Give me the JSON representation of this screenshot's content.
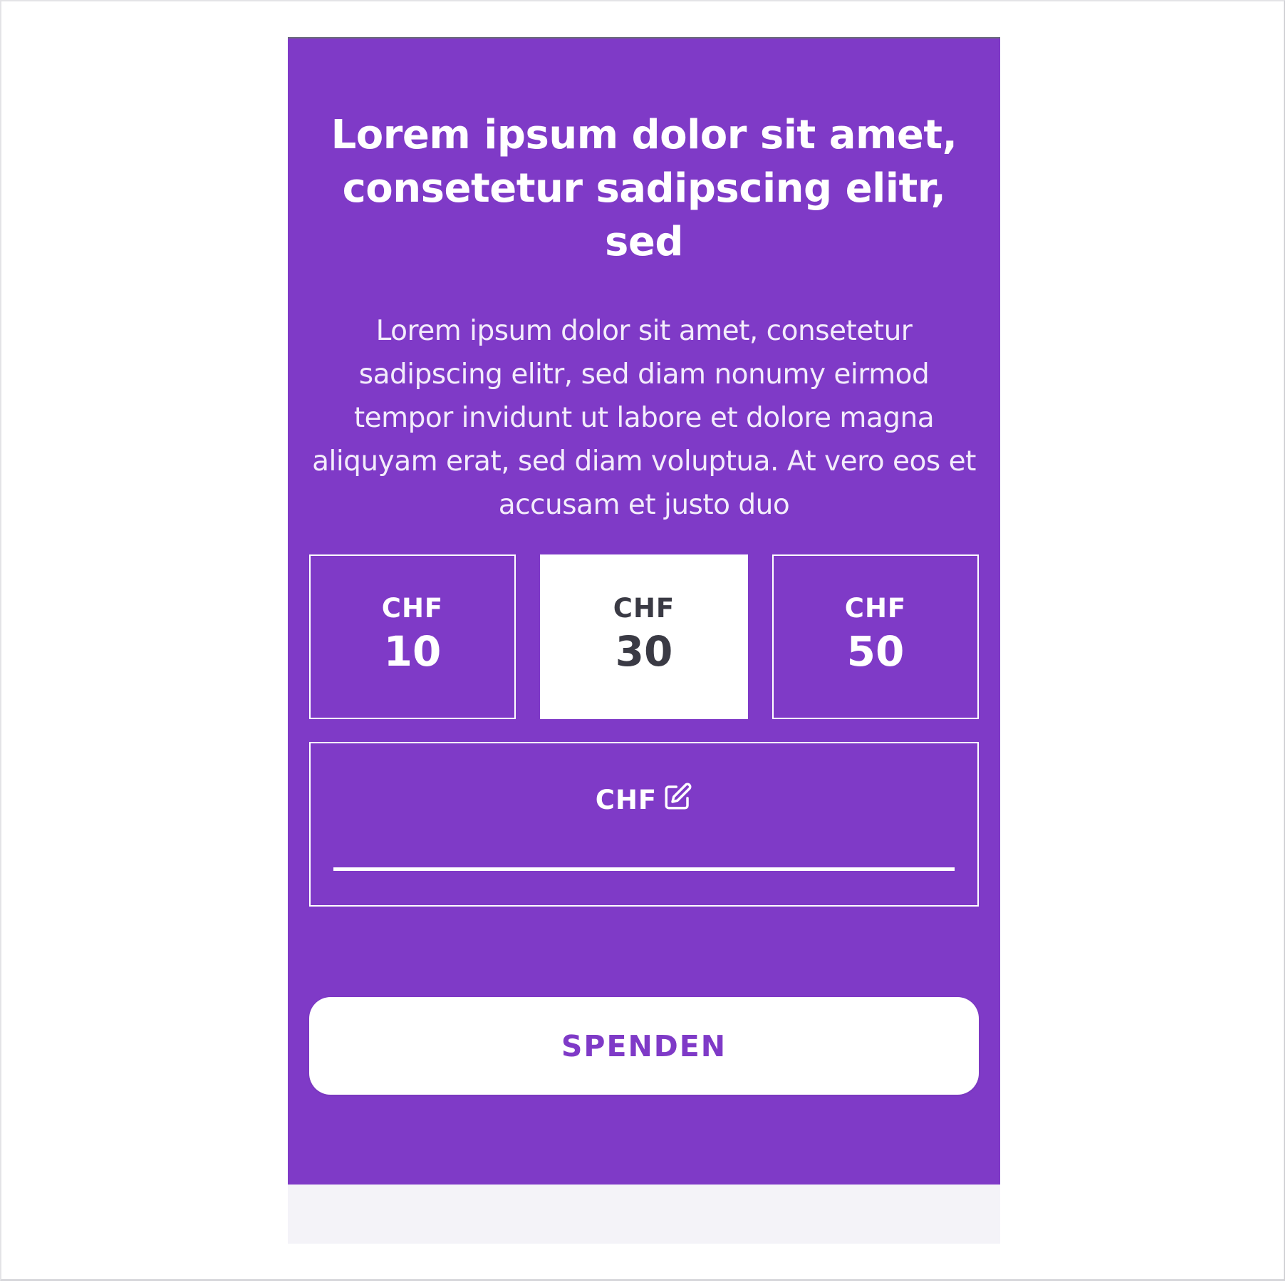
{
  "donation_card": {
    "heading": "Lorem ipsum dolor sit amet, consetetur sadipscing elitr, sed",
    "body": "Lorem ipsum dolor sit amet, consetetur sadipscing elitr, sed diam nonumy eirmod tempor invidunt ut labore et dolore magna aliquyam erat, sed diam voluptua. At vero eos et accusam et justo duo",
    "amounts": [
      {
        "currency": "CHF",
        "value": "10",
        "selected": false
      },
      {
        "currency": "CHF",
        "value": "30",
        "selected": true
      },
      {
        "currency": "CHF",
        "value": "50",
        "selected": false
      }
    ],
    "custom_amount": {
      "currency": "CHF",
      "icon": "edit-pencil-icon",
      "value": ""
    },
    "donate_label": "SPENDEN"
  },
  "colors": {
    "brand_purple": "#7f3ac7",
    "selected_text": "#3a3a44",
    "white": "#ffffff",
    "footer_strip": "#f4f3f8"
  }
}
